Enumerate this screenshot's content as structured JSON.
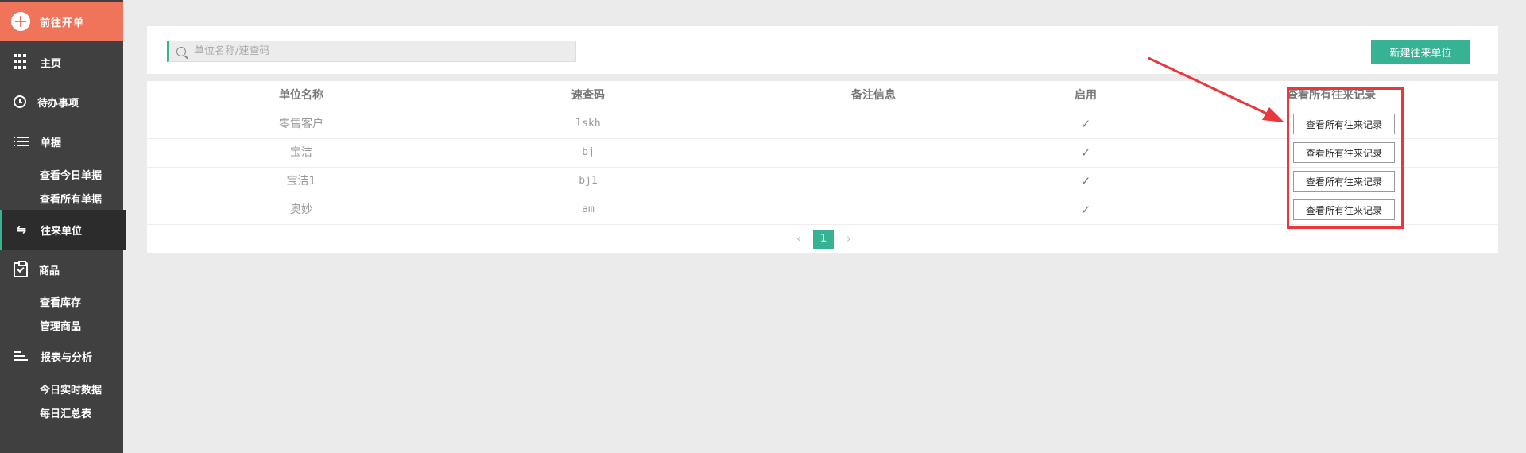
{
  "sidebar": {
    "new_order": "前往开单",
    "items": [
      {
        "label": "主页",
        "icon": "grid-icon"
      },
      {
        "label": "待办事项",
        "icon": "clock-icon"
      },
      {
        "label": "单据",
        "icon": "list-icon",
        "sub": [
          "查看今日单据",
          "查看所有单据"
        ]
      },
      {
        "label": "往来单位",
        "icon": "swap-icon",
        "active": true
      },
      {
        "label": "商品",
        "icon": "clipboard-check-icon",
        "sub": [
          "查看库存",
          "管理商品"
        ]
      },
      {
        "label": "报表与分析",
        "icon": "chart-lines-icon",
        "sub": [
          "今日实时数据",
          "每日汇总表"
        ]
      }
    ]
  },
  "search": {
    "placeholder": "单位名称/速查码",
    "value": ""
  },
  "toolbar": {
    "new_unit_label": "新建往来单位"
  },
  "table": {
    "headers": [
      "单位名称",
      "速查码",
      "备注信息",
      "启用",
      "查看所有往来记录"
    ],
    "rows": [
      {
        "name": "零售客户",
        "code": "lskh",
        "remark": "",
        "enabled": "✓",
        "action": "查看所有往来记录"
      },
      {
        "name": "宝洁",
        "code": "bj",
        "remark": "",
        "enabled": "✓",
        "action": "查看所有往来记录"
      },
      {
        "name": "宝洁1",
        "code": "bj1",
        "remark": "",
        "enabled": "✓",
        "action": "查看所有往来记录"
      },
      {
        "name": "奥妙",
        "code": "am",
        "remark": "",
        "enabled": "✓",
        "action": "查看所有往来记录"
      }
    ]
  },
  "pagination": {
    "prev": "‹",
    "current": "1",
    "next": "›"
  },
  "colors": {
    "accent": "#37b394",
    "brand_orange": "#f0745a",
    "sidebar_bg": "#404040",
    "annotation_red": "#e8383d"
  }
}
